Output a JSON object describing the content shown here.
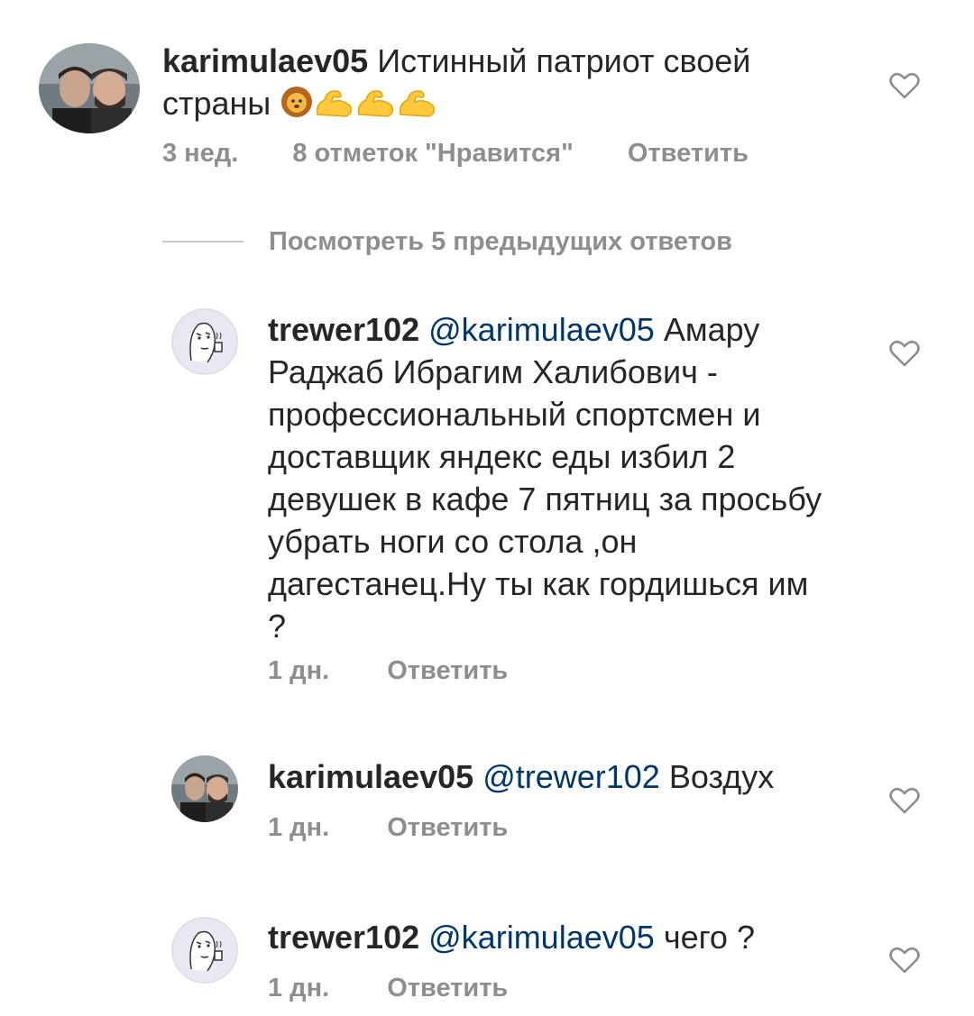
{
  "comments": [
    {
      "username": "karimulaev05",
      "mention": "",
      "text": "Истинный патриот своей страны",
      "emojis": [
        "lion-emoji",
        "flexed-biceps-emoji",
        "flexed-biceps-emoji",
        "flexed-biceps-emoji"
      ],
      "time": "3 нед.",
      "likes": "8 отметок \"Нравится\"",
      "reply": "Ответить",
      "avatar_icon": "photo-avatar"
    },
    {
      "username": "trewer102",
      "mention": "@karimulaev05",
      "text": "Амару Раджаб Ибрагим Халибович - профессиональный спортсмен и доставщик яндекс еды избил 2 девушек в кафе 7 пятниц за просьбу убрать ноги со стола ,он дагестанец.Ну ты как гордишься им ?",
      "time": "1 дн.",
      "reply": "Ответить",
      "avatar_icon": "meme-face-avatar"
    },
    {
      "username": "karimulaev05",
      "mention": "@trewer102",
      "text": "Воздух",
      "time": "1 дн.",
      "reply": "Ответить",
      "avatar_icon": "photo-avatar"
    },
    {
      "username": "trewer102",
      "mention": "@karimulaev05",
      "text": "чего ?",
      "time": "1 дн.",
      "reply": "Ответить",
      "avatar_icon": "meme-face-avatar"
    }
  ],
  "view_replies": "Посмотреть 5 предыдущих ответов",
  "colors": {
    "text": "#262626",
    "mention": "#00376b",
    "meta": "#8e8e8e",
    "divider": "#c7c7c7",
    "heart": "#8e8e8e"
  }
}
